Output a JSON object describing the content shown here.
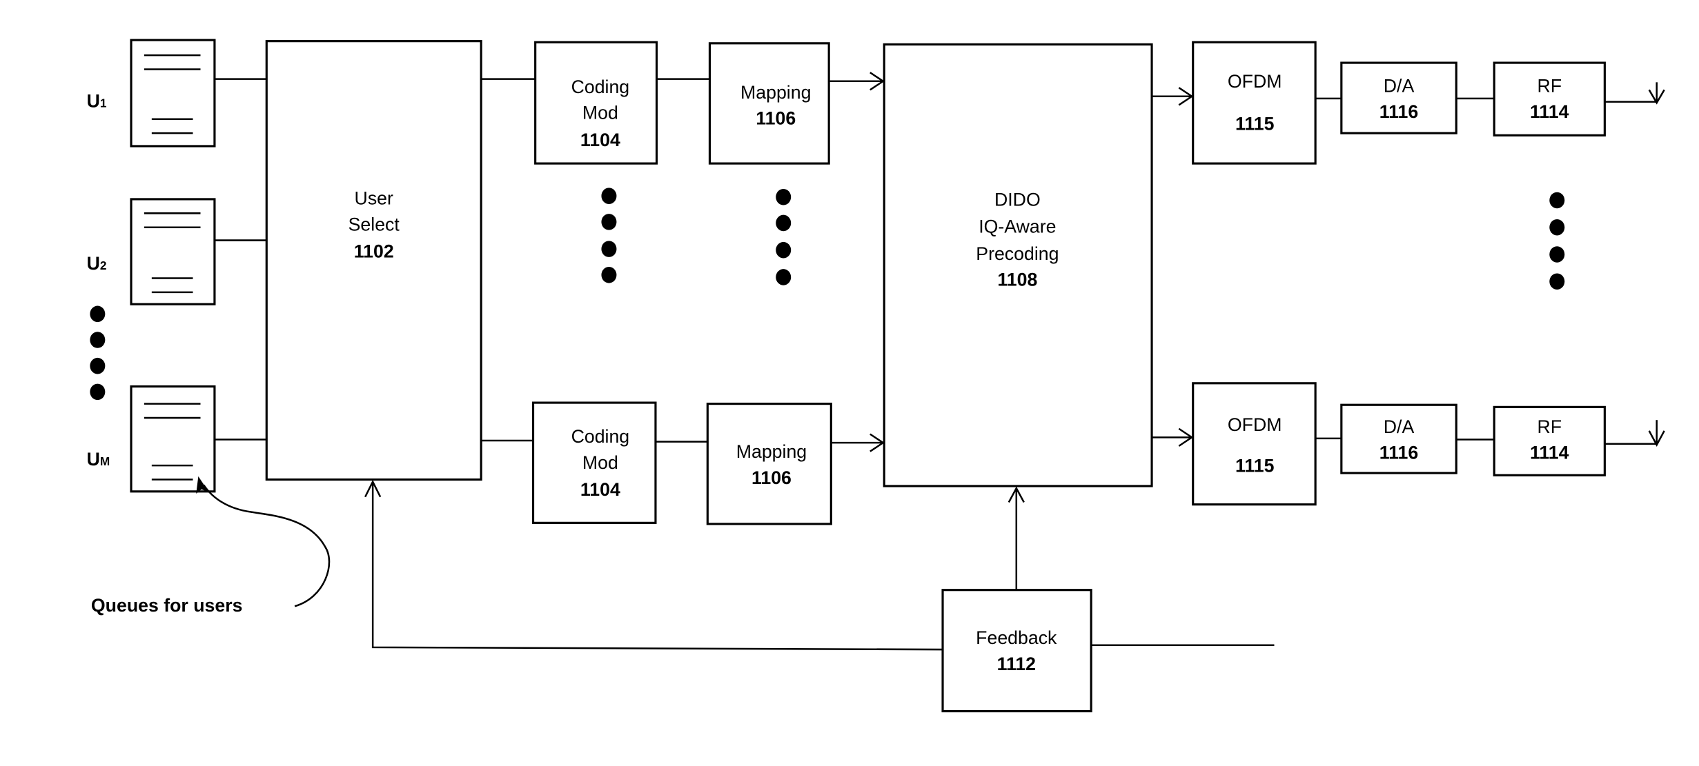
{
  "diagram": {
    "users": [
      {
        "prefix": "U",
        "sub": "1"
      },
      {
        "prefix": "U",
        "sub": "2"
      },
      {
        "prefix": "U",
        "sub": "M"
      }
    ],
    "queues_annotation": "Queues for users",
    "user_select": {
      "lines": [
        "User",
        "Select"
      ],
      "ref": "1102"
    },
    "coding_mod": {
      "lines": [
        "Coding",
        "Mod"
      ],
      "ref": "1104"
    },
    "mapping": {
      "lines": [
        "Mapping"
      ],
      "ref": "1106"
    },
    "precoding": {
      "lines": [
        "DIDO",
        "IQ-Aware",
        "Precoding"
      ],
      "ref": "1108"
    },
    "ofdm": {
      "lines": [
        "OFDM"
      ],
      "ref": "1115"
    },
    "da": {
      "lines": [
        "D/A"
      ],
      "ref": "1116"
    },
    "rf": {
      "lines": [
        "RF"
      ],
      "ref": "1114"
    },
    "feedback": {
      "lines": [
        "Feedback"
      ],
      "ref": "1112"
    },
    "ellipsis_icon": "vertical-dots-icon",
    "antenna_icon": "antenna-icon"
  }
}
